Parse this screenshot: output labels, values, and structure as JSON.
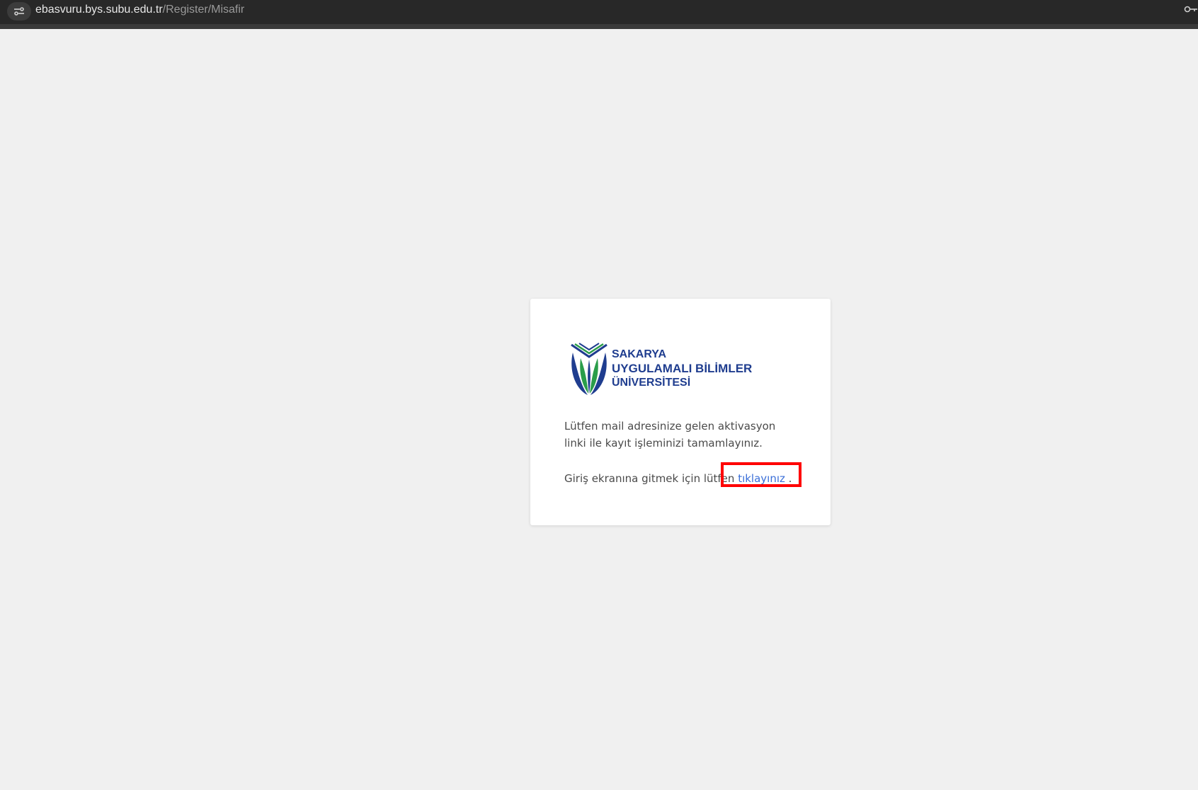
{
  "browser": {
    "url_host": "ebasvuru.bys.subu.edu.tr",
    "url_path": "/Register/Misafir",
    "icons": [
      "site-info-icon",
      "key-icon"
    ]
  },
  "card": {
    "logo": {
      "line1": "SAKARYA",
      "line2": "UYGULAMALI BİLİMLER",
      "line3": "ÜNİVERSİTESİ",
      "colors": {
        "blue": "#1f3d8f",
        "green": "#2a9d4a",
        "navy": "#1f3d8f"
      }
    },
    "message": "Lütfen mail adresinize gelen aktivasyon linki ile kayıt işleminizi tamamlayınız.",
    "login_prefix": "Giriş ekranına gitmek için lütfen ",
    "login_link": "tıklayınız",
    "login_suffix": " ."
  },
  "annotation": {
    "highlight_color": "#ff0000"
  }
}
